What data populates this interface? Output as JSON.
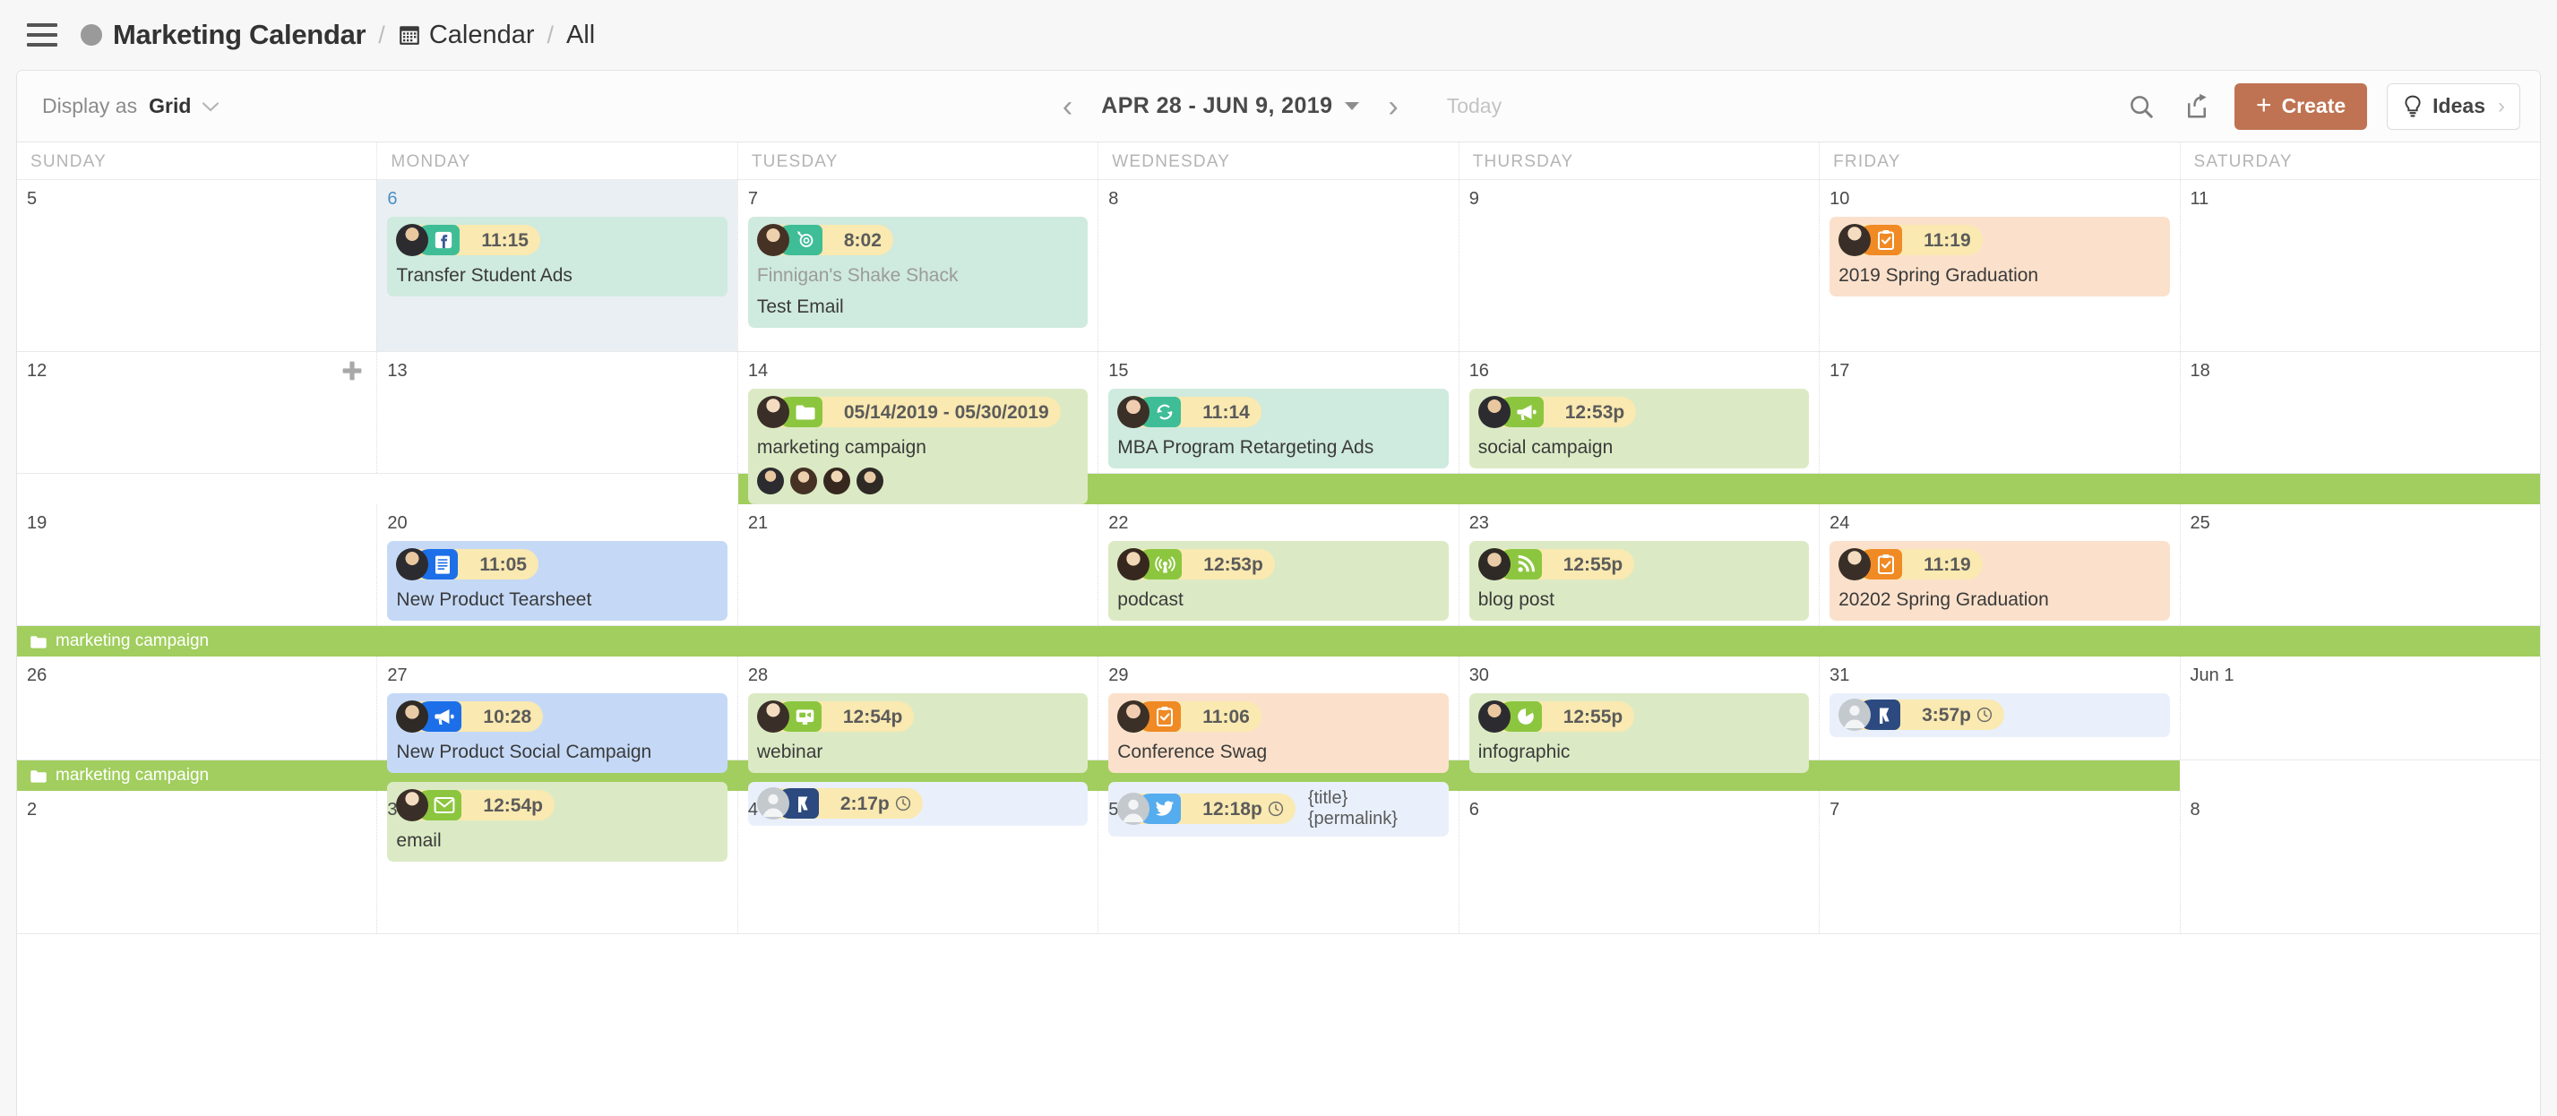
{
  "breadcrumb": {
    "menu_icon": "hamburger-icon",
    "workspace": "Marketing Calendar",
    "separator": "/",
    "section": "Calendar",
    "filter": "All"
  },
  "toolbar": {
    "display_label": "Display as",
    "display_value": "Grid",
    "prev_label": "‹",
    "next_label": "›",
    "date_range": "APR 28 - JUN 9, 2019",
    "today_label": "Today",
    "search_icon": "search-icon",
    "share_icon": "share-icon",
    "create_label": "Create",
    "create_plus": "+",
    "create_color": "#bf7352",
    "ideas_label": "Ideas",
    "ideas_chev": "›"
  },
  "weekdays": [
    "SUNDAY",
    "MONDAY",
    "TUESDAY",
    "WEDNESDAY",
    "THURSDAY",
    "FRIDAY",
    "SATURDAY"
  ],
  "campaign_band": {
    "label": "marketing campaign",
    "color": "#a1ce5e",
    "icon": "folder-icon"
  },
  "weeks": [
    {
      "days": [
        {
          "num": "5"
        },
        {
          "num": "6",
          "today": true,
          "events": [
            {
              "type": "task",
              "color": "teal",
              "badge": "facebook-icon",
              "badge_color": "teal",
              "time": "11:15",
              "title": "Transfer Student Ads"
            }
          ]
        },
        {
          "num": "7",
          "events": [
            {
              "type": "email",
              "color": "teal",
              "badge": "email-blast-icon",
              "badge_color": "teal",
              "time": "8:02",
              "subtitle": "Finnigan's Shake Shack",
              "title": "Test Email"
            }
          ]
        },
        {
          "num": "8"
        },
        {
          "num": "9"
        },
        {
          "num": "10",
          "events": [
            {
              "type": "task",
              "color": "orange",
              "badge": "clipboard-check-icon",
              "badge_color": "orange",
              "time": "11:19",
              "title": "2019 Spring Graduation"
            }
          ]
        },
        {
          "num": "11"
        }
      ]
    },
    {
      "days": [
        {
          "num": "12",
          "add_button": true
        },
        {
          "num": "13"
        },
        {
          "num": "14",
          "events": [
            {
              "type": "campaign",
              "color": "green",
              "badge": "folder-icon",
              "badge_color": "green",
              "time": "05/14/2019 - 05/30/2019",
              "title": "marketing campaign",
              "avatars": 4
            }
          ]
        },
        {
          "num": "15",
          "events": [
            {
              "type": "retargeting",
              "color": "teal",
              "badge": "refresh-icon",
              "badge_color": "teal",
              "time": "11:14",
              "title": "MBA Program Retargeting Ads"
            }
          ]
        },
        {
          "num": "16",
          "events": [
            {
              "type": "social-campaign",
              "color": "green",
              "badge": "megaphone-icon",
              "badge_color": "green",
              "time": "12:53p",
              "title": "social campaign"
            }
          ]
        },
        {
          "num": "17"
        },
        {
          "num": "18"
        }
      ],
      "band": {
        "start": 2,
        "end": 7
      }
    },
    {
      "days": [
        {
          "num": "19"
        },
        {
          "num": "20",
          "events": [
            {
              "type": "document",
              "color": "blue",
              "badge": "document-icon",
              "badge_color": "blue",
              "time": "11:05",
              "title": "New Product Tearsheet"
            }
          ]
        },
        {
          "num": "21"
        },
        {
          "num": "22",
          "events": [
            {
              "type": "podcast",
              "color": "green",
              "badge": "broadcast-icon",
              "badge_color": "green",
              "time": "12:53p",
              "title": "podcast"
            }
          ]
        },
        {
          "num": "23",
          "events": [
            {
              "type": "blog",
              "color": "green",
              "badge": "rss-icon",
              "badge_color": "green",
              "time": "12:55p",
              "title": "blog post"
            }
          ]
        },
        {
          "num": "24",
          "events": [
            {
              "type": "task",
              "color": "orange",
              "badge": "clipboard-check-icon",
              "badge_color": "orange",
              "time": "11:19",
              "title": "20202 Spring Graduation"
            }
          ]
        },
        {
          "num": "25"
        }
      ],
      "band": {
        "start": 0,
        "end": 7
      }
    },
    {
      "days": [
        {
          "num": "26"
        },
        {
          "num": "27",
          "events": [
            {
              "type": "social-campaign",
              "color": "blue",
              "badge": "megaphone-icon",
              "badge_color": "blue",
              "time": "10:28",
              "title": "New Product Social Campaign"
            },
            {
              "type": "email",
              "color": "green",
              "badge": "envelope-icon",
              "badge_color": "green",
              "time": "12:54p",
              "title": "email"
            }
          ]
        },
        {
          "num": "28",
          "events": [
            {
              "type": "webinar",
              "color": "green",
              "badge": "webinar-icon",
              "badge_color": "green",
              "time": "12:54p",
              "title": "webinar"
            },
            {
              "type": "social-post",
              "color": "social",
              "badge": "linkedin-icon",
              "badge_color": "navy",
              "time": "2:17p",
              "clock": true,
              "title": ""
            }
          ]
        },
        {
          "num": "29",
          "events": [
            {
              "type": "task",
              "color": "orange",
              "badge": "clipboard-check-icon",
              "badge_color": "orange",
              "time": "11:06",
              "title": "Conference Swag"
            },
            {
              "type": "social-post",
              "color": "social",
              "badge": "twitter-icon",
              "badge_color": "twitter",
              "time": "12:18p",
              "clock": true,
              "title": "{title} {permalink}"
            }
          ]
        },
        {
          "num": "30",
          "events": [
            {
              "type": "infographic",
              "color": "green",
              "badge": "pie-chart-icon",
              "badge_color": "green",
              "time": "12:55p",
              "title": "infographic"
            }
          ]
        },
        {
          "num": "31",
          "events": [
            {
              "type": "social-post",
              "color": "social",
              "badge": "linkedin-icon",
              "badge_color": "navy",
              "time": "3:57p",
              "clock": true,
              "title": ""
            }
          ]
        },
        {
          "num": "Jun 1"
        }
      ],
      "band": {
        "start": 0,
        "end": 6
      }
    },
    {
      "days": [
        {
          "num": "2"
        },
        {
          "num": "3"
        },
        {
          "num": "4"
        },
        {
          "num": "5"
        },
        {
          "num": "6"
        },
        {
          "num": "7"
        },
        {
          "num": "8"
        }
      ]
    }
  ]
}
